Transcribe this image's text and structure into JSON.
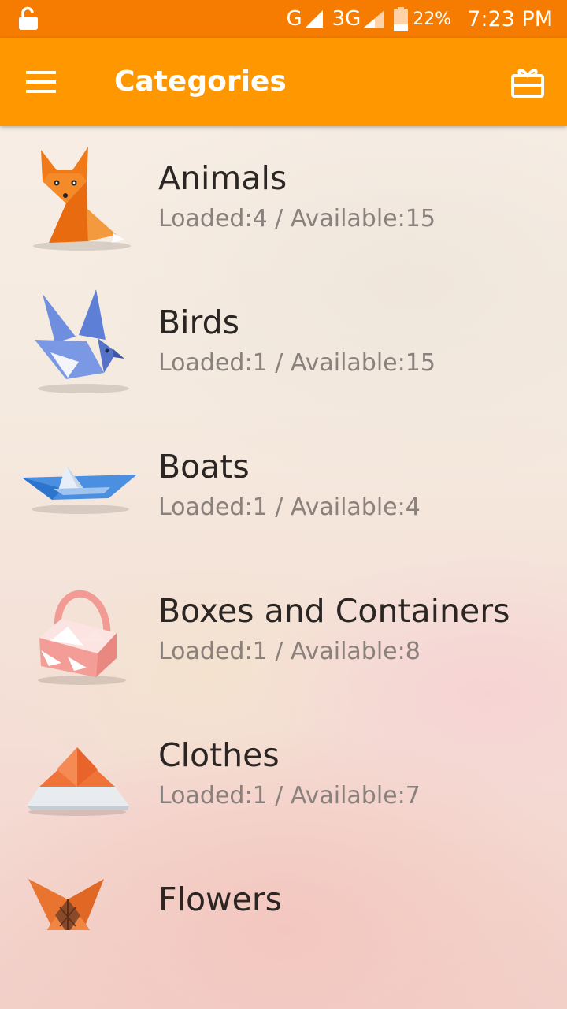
{
  "status_bar": {
    "network_1": "G",
    "network_2": "3G",
    "battery": "22%",
    "time": "7:23 PM"
  },
  "app_bar": {
    "title": "Categories",
    "menu_icon": "hamburger-menu-icon",
    "action_icon": "gift-icon"
  },
  "colors": {
    "status_bar": "#f57c00",
    "app_bar": "#ff9800"
  },
  "categories": [
    {
      "name": "Animals",
      "meta": "Loaded:4 / Available:15",
      "icon": "origami-fox"
    },
    {
      "name": "Birds",
      "meta": "Loaded:1 / Available:15",
      "icon": "origami-bird"
    },
    {
      "name": "Boats",
      "meta": "Loaded:1 / Available:4",
      "icon": "origami-boat"
    },
    {
      "name": "Boxes and Containers",
      "meta": "Loaded:1 / Available:8",
      "icon": "origami-basket"
    },
    {
      "name": "Clothes",
      "meta": "Loaded:1 / Available:7",
      "icon": "origami-hat"
    },
    {
      "name": "Flowers",
      "meta": "",
      "icon": "origami-flower"
    }
  ]
}
